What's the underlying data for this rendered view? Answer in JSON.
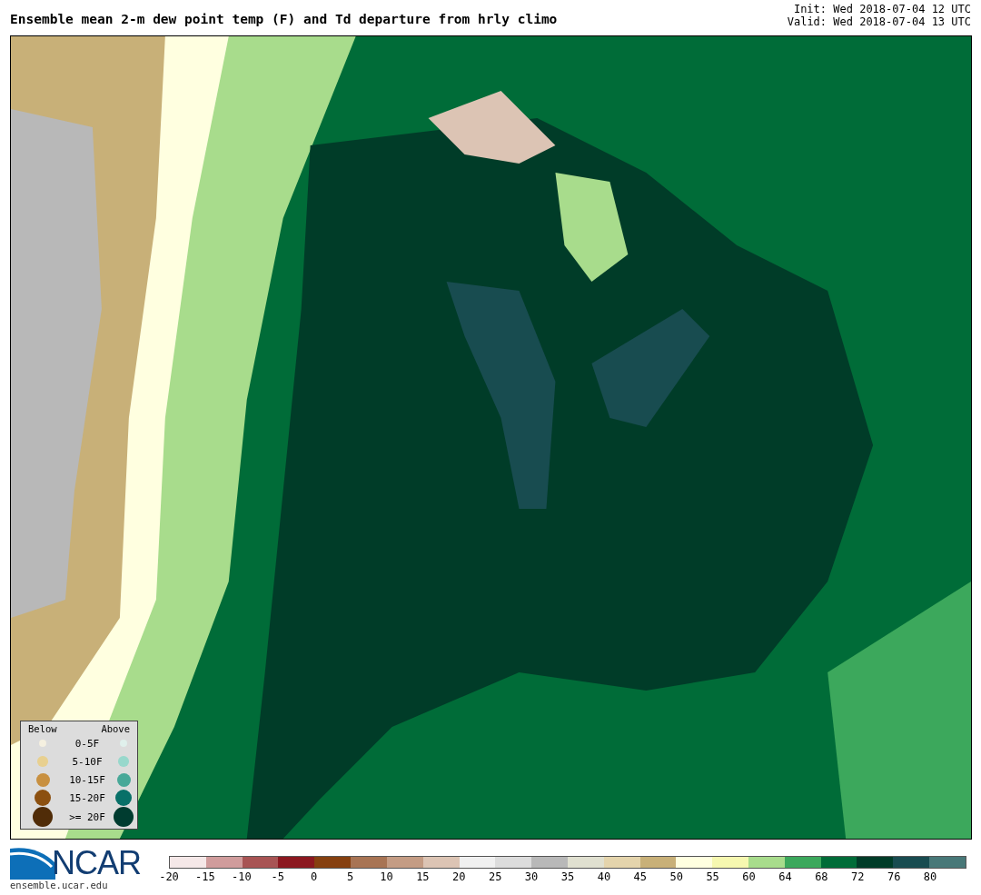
{
  "title": "Ensemble mean 2-m dew point temp (F) and Td departure from hrly climo",
  "init": "Init: Wed 2018-07-04 12 UTC",
  "valid": "Valid: Wed 2018-07-04 13 UTC",
  "legend": {
    "below": "Below",
    "above": "Above",
    "rows": [
      {
        "label": "0-5F",
        "below": {
          "color": "#f5f0e0"
        },
        "above": {
          "color": "#e0f0ec"
        }
      },
      {
        "label": "5-10F",
        "below": {
          "color": "#e8d090"
        },
        "above": {
          "color": "#98d8cc"
        }
      },
      {
        "label": "10-15F",
        "below": {
          "color": "#c89040"
        },
        "above": {
          "color": "#48a898"
        }
      },
      {
        "label": "15-20F",
        "below": {
          "color": "#8c5010"
        },
        "above": {
          "color": "#087068"
        }
      },
      {
        "label": ">= 20F",
        "below": {
          "color": "#502c08"
        },
        "above": {
          "color": "#003c30"
        }
      }
    ]
  },
  "logo": {
    "text": "NCAR",
    "url": "ensemble.ucar.edu"
  },
  "colorbar": {
    "segments": [
      {
        "color": "#f5e8e8"
      },
      {
        "color": "#d09c9c"
      },
      {
        "color": "#a85454"
      },
      {
        "color": "#8c1820"
      },
      {
        "color": "#864010"
      },
      {
        "color": "#a87454"
      },
      {
        "color": "#c49c84"
      },
      {
        "color": "#dcc4b4"
      },
      {
        "color": "#f0f0f0"
      },
      {
        "color": "#dcdcdc"
      },
      {
        "color": "#b8b8b8"
      },
      {
        "color": "#e0e0d0"
      },
      {
        "color": "#e4d4ac"
      },
      {
        "color": "#c8b078"
      },
      {
        "color": "#ffffe0"
      },
      {
        "color": "#f6f8b0"
      },
      {
        "color": "#a8dc8c"
      },
      {
        "color": "#3ca85c"
      },
      {
        "color": "#006c38"
      },
      {
        "color": "#003c28"
      },
      {
        "color": "#184c50"
      },
      {
        "color": "#487878"
      }
    ],
    "ticks": [
      "-20",
      "-15",
      "-10",
      "-5",
      "0",
      "5",
      "10",
      "15",
      "20",
      "25",
      "30",
      "35",
      "40",
      "45",
      "50",
      "55",
      "60",
      "64",
      "68",
      "72",
      "76",
      "80"
    ]
  }
}
